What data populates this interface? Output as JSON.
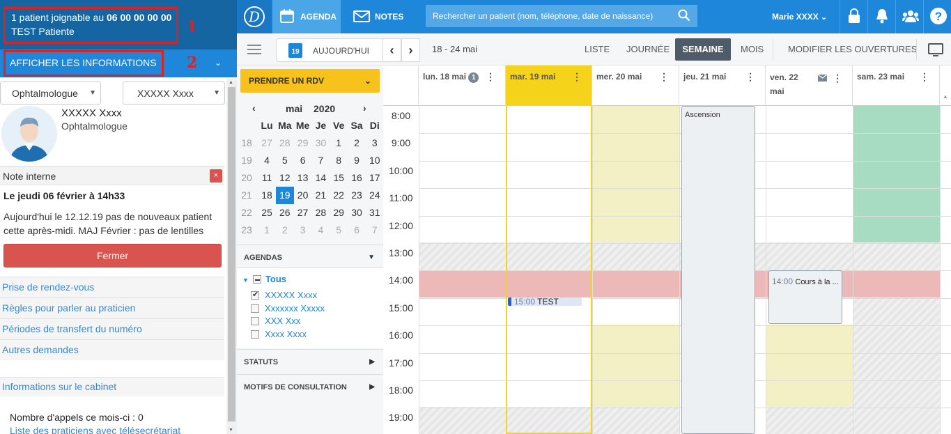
{
  "left_panel": {
    "patient_line1_prefix": "1 patient joignable au ",
    "patient_phone": "06 00 00 00 00",
    "patient_name": "TEST Patiente",
    "annotation_1": "1",
    "annotation_2": "2",
    "info_toggle": "AFFICHER LES INFORMATIONS",
    "specialty_select": "Ophtalmologue",
    "practitioner_select": "XXXXX Xxxx",
    "doctor_name": "XXXXX Xxxx",
    "doctor_role": "Ophtalmologue",
    "note_title": "Note interne",
    "note_close_x": "×",
    "note_date": "Le jeudi 06 février à 14h33",
    "note_text": "Aujourd'hui le 12.12.19 pas de nouveaux patient cette après-midi. MAJ Février : pas de lentilles",
    "close_button": "Fermer",
    "links": [
      "Prise de rendez-vous",
      "Règles pour parler au praticien",
      "Périodes de transfert du numéro",
      "Autres demandes"
    ],
    "cabinet_link": "Informations sur le cabinet",
    "calls_count": "Nombre d'appels ce mois-ci : 0",
    "practitioners_link": "Liste des praticiens avec télésecrétariat"
  },
  "topbar": {
    "tab_agenda": "AGENDA",
    "tab_notes": "NOTES",
    "search_placeholder": "Rechercher un patient (nom, téléphone, date de naissance)",
    "user": "Marie XXXX",
    "icons": [
      "lock-icon",
      "bell-icon",
      "users-icon",
      "help-icon"
    ]
  },
  "toolbar": {
    "today_day": "19",
    "today_label": "AUJOURD'HUI",
    "prev": "‹",
    "next": "›",
    "range": "18 - 24 mai",
    "views": [
      "LISTE",
      "JOURNÉE",
      "SEMAINE",
      "MOIS"
    ],
    "active_view": "SEMAINE",
    "modify_hours": "MODIFIER LES OUVERTURES"
  },
  "sidebar": {
    "book_button": "PRENDRE UN RDV",
    "cal_month": "mai",
    "cal_year": "2020",
    "weekday_headers": [
      "Lu",
      "Ma",
      "Me",
      "Je",
      "Ve",
      "Sa",
      "Di"
    ],
    "weeks": [
      {
        "wk": "18",
        "days": [
          "27",
          "28",
          "29",
          "30",
          "1",
          "2",
          "3"
        ]
      },
      {
        "wk": "19",
        "days": [
          "4",
          "5",
          "6",
          "7",
          "8",
          "9",
          "10"
        ]
      },
      {
        "wk": "20",
        "days": [
          "11",
          "12",
          "13",
          "14",
          "15",
          "16",
          "17"
        ]
      },
      {
        "wk": "21",
        "days": [
          "18",
          "19",
          "20",
          "21",
          "22",
          "23",
          "24"
        ]
      },
      {
        "wk": "22",
        "days": [
          "25",
          "26",
          "27",
          "28",
          "29",
          "30",
          "31"
        ]
      },
      {
        "wk": "23",
        "days": [
          "1",
          "2",
          "3",
          "4",
          "5",
          "6",
          "7"
        ]
      }
    ],
    "selected_day": "19",
    "agendas_title": "AGENDAS",
    "agendas_all": "Tous",
    "agendas": [
      {
        "name": "XXXXX Xxxx",
        "checked": true
      },
      {
        "name": "Xxxxxxx Xxxxx",
        "checked": false
      },
      {
        "name": "XXX Xxx",
        "checked": false
      },
      {
        "name": "Xxxx Xxxx",
        "checked": false
      }
    ],
    "statuts_title": "STATUTS",
    "motifs_title": "MOTIFS DE CONSULTATION"
  },
  "agenda": {
    "days": [
      {
        "label": "lun. 18 mai",
        "badge": "1"
      },
      {
        "label": "mar. 19 mai"
      },
      {
        "label": "mer. 20 mai"
      },
      {
        "label": "jeu. 21 mai"
      },
      {
        "label": "ven. 22 mai"
      },
      {
        "label": "sam. 23 mai"
      }
    ],
    "hours": [
      "8:00",
      "9:00",
      "10:00",
      "11:00",
      "12:00",
      "13:00",
      "14:00",
      "15:00",
      "16:00",
      "17:00",
      "18:00",
      "19:00"
    ],
    "holiday": "Ascension",
    "events": [
      {
        "time": "15:00",
        "title": "TEST"
      },
      {
        "time": "14:00",
        "title": "Cours à la ..."
      }
    ],
    "colors": {
      "today": "#f6d31b",
      "yellow": "#f2f0c4",
      "green": "#a7dcc3",
      "pink": "#ecb8b8",
      "blue": "#1e87d9"
    }
  }
}
